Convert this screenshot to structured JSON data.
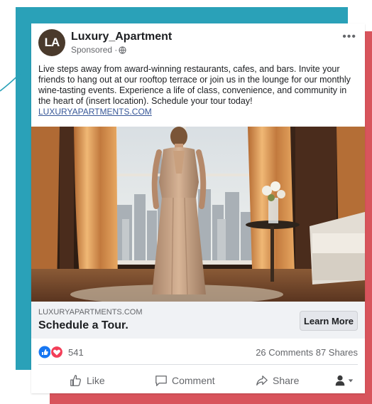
{
  "ad": {
    "page_name": "Luxury_Apartment",
    "avatar_initials": "LA",
    "sponsored_label": "Sponsored ·",
    "post_text": "Live steps away from award-winning restaurants, cafes, and bars. Invite your friends to hang out at our rooftop terrace or join us in the lounge for our monthly wine-tasting events. Experience a life of class, convenience, and community in the heart of (insert location). Schedule your tour today!",
    "post_link": "LUXURYAPARTMENTS.COM"
  },
  "link_preview": {
    "domain": "LUXURYAPARTMENTS.COM",
    "title": "Schedule a Tour.",
    "cta_label": "Learn More"
  },
  "engagement": {
    "reaction_count": "541",
    "comments": "26 Comments",
    "shares": "87 Shares"
  },
  "actions": {
    "like": "Like",
    "comment": "Comment",
    "share": "Share"
  },
  "colors": {
    "teal_panel": "#2aa1b8",
    "red_panel": "#d8545c",
    "link": "#385898",
    "like_blue": "#1877f2",
    "love_red": "#f33e58"
  }
}
